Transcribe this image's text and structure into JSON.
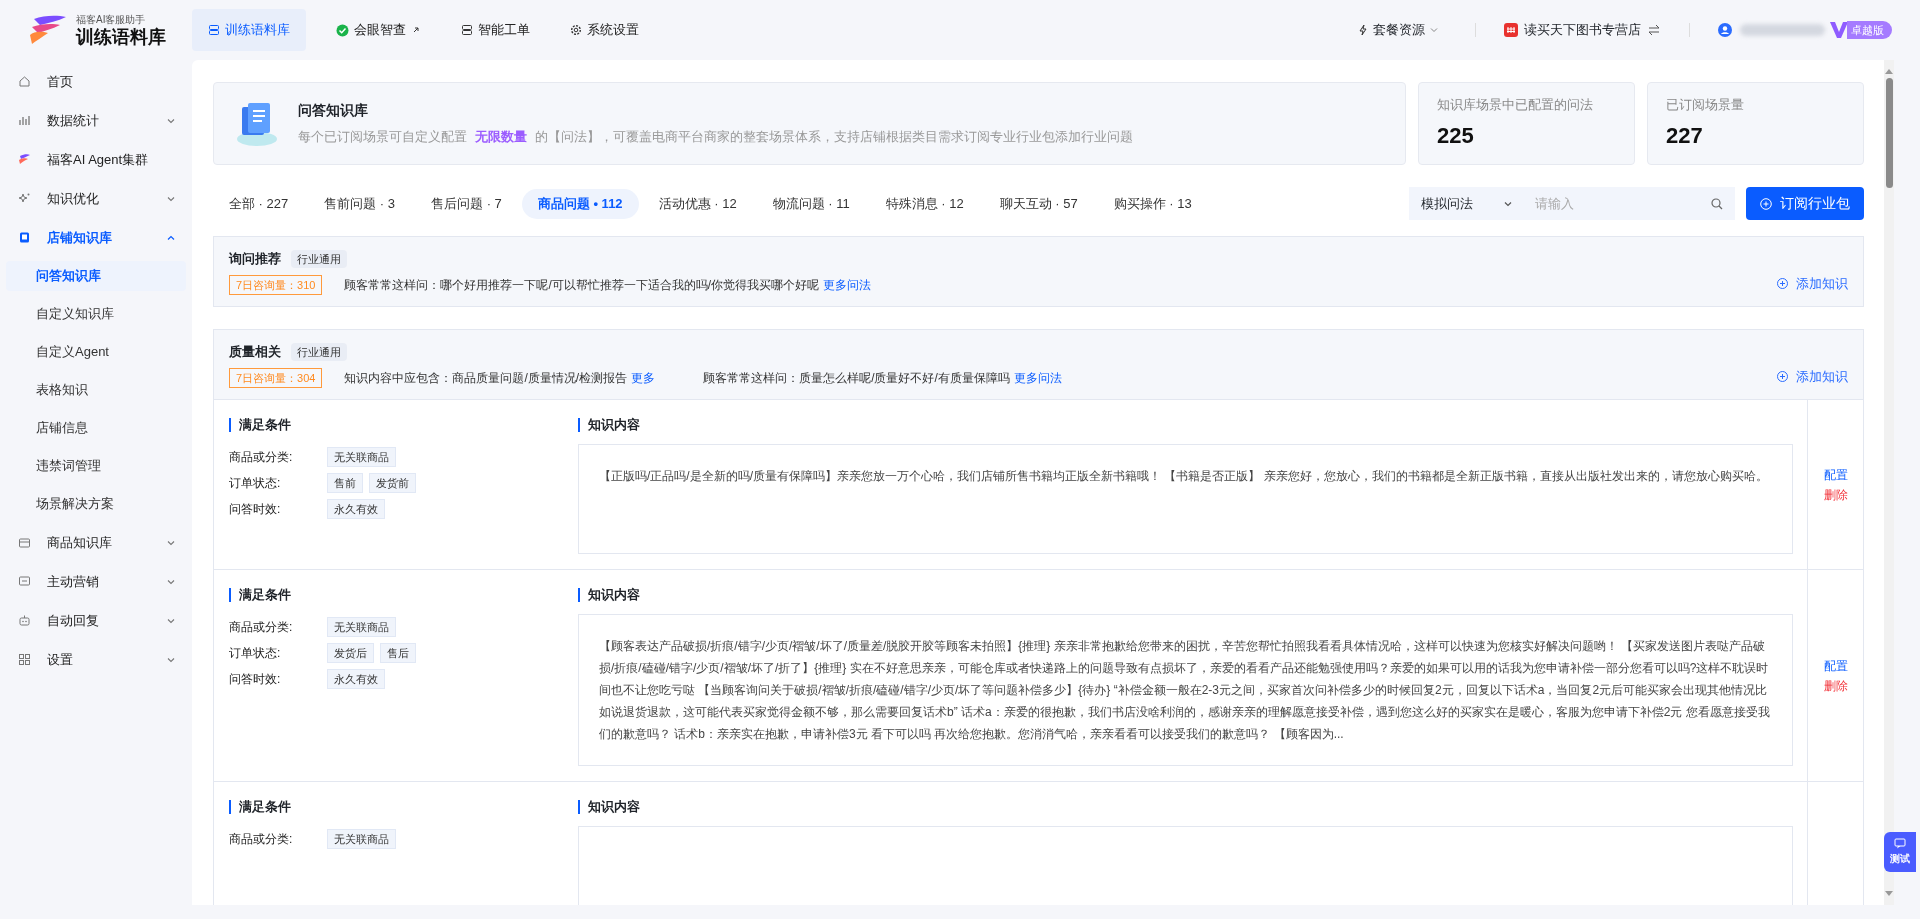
{
  "brand": {
    "subtitle": "福客AI客服助手",
    "title": "训练语料库"
  },
  "top_nav": [
    {
      "label": "训练语料库",
      "selected": true,
      "kind": "db",
      "external": false
    },
    {
      "label": "会眼智查",
      "selected": false,
      "kind": "check",
      "external": true
    },
    {
      "label": "智能工单",
      "selected": false,
      "kind": "db",
      "external": false
    },
    {
      "label": "系统设置",
      "selected": false,
      "kind": "gear",
      "external": false
    }
  ],
  "top_right": {
    "plan": "套餐资源",
    "shop": "读买天下图书专营店",
    "edition": "卓越版"
  },
  "sidebar": {
    "items": [
      {
        "label": "首页",
        "kind": "home",
        "selected": false
      },
      {
        "label": "数据统计",
        "kind": "chart",
        "expanded": false,
        "selected": false
      },
      {
        "label": "福客AI Agent集群",
        "kind": "logo",
        "selected": false
      },
      {
        "label": "知识优化",
        "kind": "spark",
        "expanded": false,
        "selected": false
      },
      {
        "label": "店铺知识库",
        "kind": "book",
        "expanded": true,
        "selected": true,
        "children": [
          {
            "label": "问答知识库",
            "selected": true
          },
          {
            "label": "自定义知识库",
            "selected": false
          },
          {
            "label": "自定义Agent",
            "selected": false
          },
          {
            "label": "表格知识",
            "selected": false
          },
          {
            "label": "店铺信息",
            "selected": false
          },
          {
            "label": "违禁词管理",
            "selected": false
          },
          {
            "label": "场景解决方案",
            "selected": false
          }
        ]
      },
      {
        "label": "商品知识库",
        "kind": "box",
        "expanded": false,
        "selected": false
      },
      {
        "label": "主动营销",
        "kind": "chat",
        "expanded": false,
        "selected": false
      },
      {
        "label": "自动回复",
        "kind": "robot",
        "expanded": false,
        "selected": false
      },
      {
        "label": "设置",
        "kind": "grid",
        "expanded": false,
        "selected": false
      }
    ]
  },
  "intro": {
    "title": "问答知识库",
    "desc_before": "每个已订阅场景可自定义配置",
    "highlight": "无限数量",
    "desc_after": "的【问法】，可覆盖电商平台商家的整套场景体系，支持店铺根据类目需求订阅专业行业包添加行业问题"
  },
  "stats": [
    {
      "label": "知识库场景中已配置的问法",
      "value": "225"
    },
    {
      "label": "已订阅场景量",
      "value": "227"
    }
  ],
  "tabs": [
    {
      "label": "全部 · 227",
      "selected": false
    },
    {
      "label": "售前问题 · 3",
      "selected": false
    },
    {
      "label": "售后问题 · 7",
      "selected": false
    },
    {
      "label": "商品问题 • 112",
      "selected": true
    },
    {
      "label": "活动优惠 · 12",
      "selected": false
    },
    {
      "label": "物流问题 · 11",
      "selected": false
    },
    {
      "label": "特殊消息 · 12",
      "selected": false
    },
    {
      "label": "聊天互动 · 57",
      "selected": false
    },
    {
      "label": "购买操作 · 13",
      "selected": false
    }
  ],
  "search": {
    "mode": "模拟问法",
    "placeholder": "请输入"
  },
  "subscribe_button": "订阅行业包",
  "scenes": [
    {
      "title": "询问推荐",
      "tag": "行业通用",
      "count": "7日咨询量：310",
      "asks": "顾客常常这样问：哪个好用推荐一下呢/可以帮忙推荐一下适合我的吗/你觉得我买哪个好呢",
      "asks_more": "更多问法",
      "add": "添加知识"
    },
    {
      "title": "质量相关",
      "tag": "行业通用",
      "count": "7日咨询量：304",
      "include": "知识内容中应包含：商品质量问题/质量情况/检测报告",
      "include_more": "更多",
      "asks": "顾客常常这样问：质量怎么样呢/质量好不好/有质量保障吗",
      "asks_more": "更多问法",
      "add": "添加知识",
      "rules": [
        {
          "cond_title": "满足条件",
          "fields": [
            {
              "label": "商品或分类:",
              "tags": [
                "无关联商品"
              ]
            },
            {
              "label": "订单状态:",
              "tags": [
                "售前",
                "发货前"
              ]
            },
            {
              "label": "问答时效:",
              "tags": [
                "永久有效"
              ]
            }
          ],
          "content_title": "知识内容",
          "content": "【正版吗/正品吗/是全新的吗/质量有保障吗】亲亲您放一万个心哈，我们店铺所售书籍均正版全新书籍哦！ 【书籍是否正版】 亲亲您好，您放心，我们的书籍都是全新正版书籍，直接从出版社发出来的，请您放心购买哈。",
          "actions": [
            {
              "label": "配置",
              "kind": "edit"
            },
            {
              "label": "删除",
              "kind": "delete"
            }
          ]
        },
        {
          "cond_title": "满足条件",
          "fields": [
            {
              "label": "商品或分类:",
              "tags": [
                "无关联商品"
              ]
            },
            {
              "label": "订单状态:",
              "tags": [
                "发货后",
                "售后"
              ]
            },
            {
              "label": "问答时效:",
              "tags": [
                "永久有效"
              ]
            }
          ],
          "content_title": "知识内容",
          "content": "【顾客表达产品破损/折痕/错字/少页/褶皱/坏了/质量差/脱胶开胶等顾客未拍照】{推理} 亲亲非常抱歉给您带来的困扰，辛苦您帮忙拍照我看看具体情况哈，这样可以快速为您核实好解决问题哟！ 【买家发送图片表哒产品破损/折痕/磕碰/错字/少页/褶皱/坏了/折了】{推理} 实在不好意思亲亲，可能仓库或者快递路上的问题导致有点损坏了，亲爱的看看产品还能勉强使用吗？亲爱的如果可以用的话我为您申请补偿一部分您看可以吗?这样不耽误时间也不让您吃亏哒 【当顾客询问关于破损/褶皱/折痕/磕碰/错字/少页/坏了等问题补偿多少】{待办} “补偿金额一般在2-3元之间，买家首次问补偿多少的时候回复2元，回复以下话术a，当回复2元后可能买家会出现其他情况比如说退货退款，这可能代表买家觉得金额不够，那么需要回复话术b” 话术a：亲爱的很抱歉，我们书店没啥利润的，感谢亲亲的理解愿意接受补偿，遇到您这么好的买家实在是暖心，客服为您申请下补偿2元 您看愿意接受我们的歉意吗？ 话术b：亲亲实在抱歉，申请补偿3元 看下可以吗 再次给您抱歉。您消消气哈，亲亲看看可以接受我们的歉意吗？ 【顾客因为...",
          "actions": [
            {
              "label": "配置",
              "kind": "edit"
            },
            {
              "label": "删除",
              "kind": "delete"
            }
          ]
        },
        {
          "cond_title": "满足条件",
          "fields": [
            {
              "label": "商品或分类:",
              "tags": [
                "无关联商品"
              ]
            }
          ],
          "content_title": "知识内容"
        }
      ]
    }
  ],
  "test_button": "测试"
}
